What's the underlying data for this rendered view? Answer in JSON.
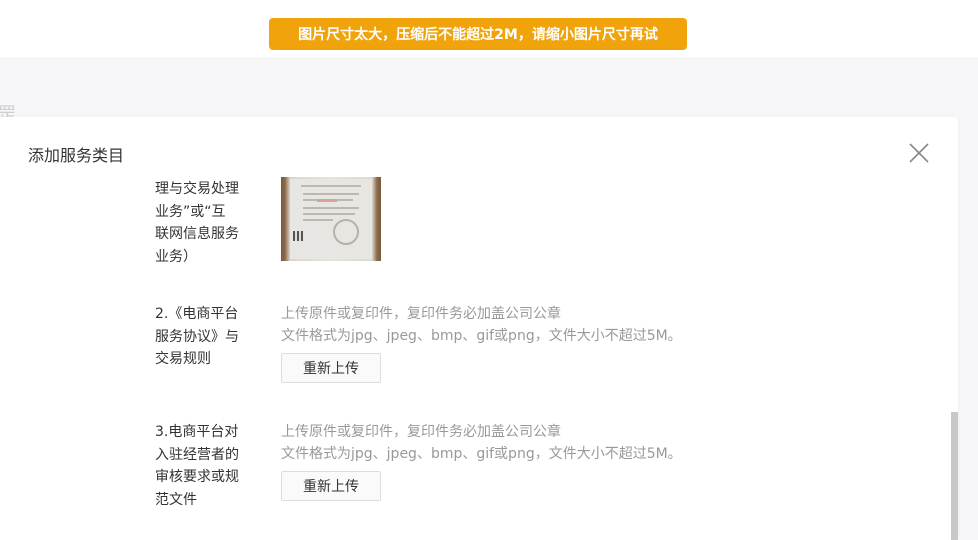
{
  "background": {
    "fragment_text": "罡"
  },
  "toast": {
    "message": "图片尺寸太大，压缩后不能超过2M，请缩小图片尺寸再试",
    "color": "#f0a30a"
  },
  "modal": {
    "title": "添加服务类目",
    "close_icon": "close-icon"
  },
  "items": [
    {
      "label_lines": [
        "理与交易处理",
        "业务”或“互",
        "联网信息服务",
        "业务）"
      ],
      "uploaded": true
    },
    {
      "label_lines": [
        "2.《电商平台",
        "服务协议》与",
        "交易规则"
      ],
      "hint_1": "上传原件或复印件，复印件务必加盖公司公章",
      "hint_2": "文件格式为jpg、jpeg、bmp、gif或png，文件大小不超过5M。",
      "button_label": "重新上传"
    },
    {
      "label_lines": [
        "3.电商平台对",
        "入驻经营者的",
        "审核要求或规",
        "范文件"
      ],
      "hint_1": "上传原件或复印件，复印件务必加盖公司公章",
      "hint_2": "文件格式为jpg、jpeg、bmp、gif或png，文件大小不超过5M。",
      "button_label": "重新上传"
    }
  ]
}
